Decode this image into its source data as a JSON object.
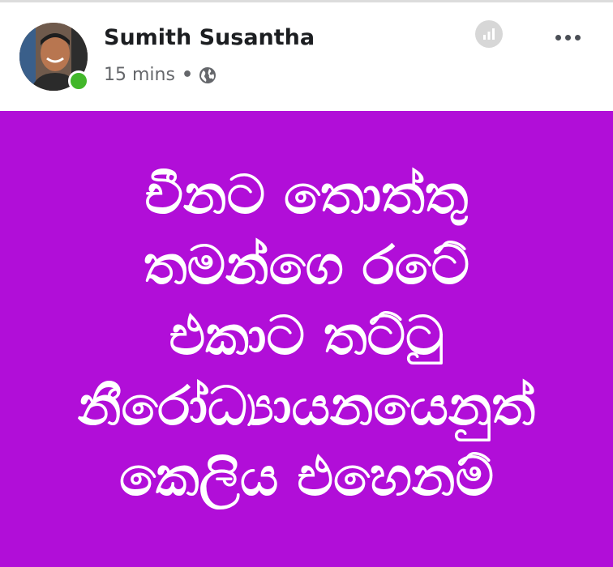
{
  "post": {
    "author": "Sumith Susantha",
    "timestamp": "15 mins",
    "separator": "•",
    "privacy_icon": "globe-icon",
    "insights_icon": "bar-chart-icon",
    "menu_icon": "more-horizontal-icon",
    "online_status_color": "#42b72a",
    "background_color": "#b10ed8",
    "text_color": "#ffffff",
    "lines": [
      "චීනට තොත්තු",
      "තමන්ගෙ රටේ",
      "එකාට තට්ටු",
      "නීරෝධ්‍යායනයෙනුත්",
      "කෙලිය එහෙනම්"
    ]
  }
}
